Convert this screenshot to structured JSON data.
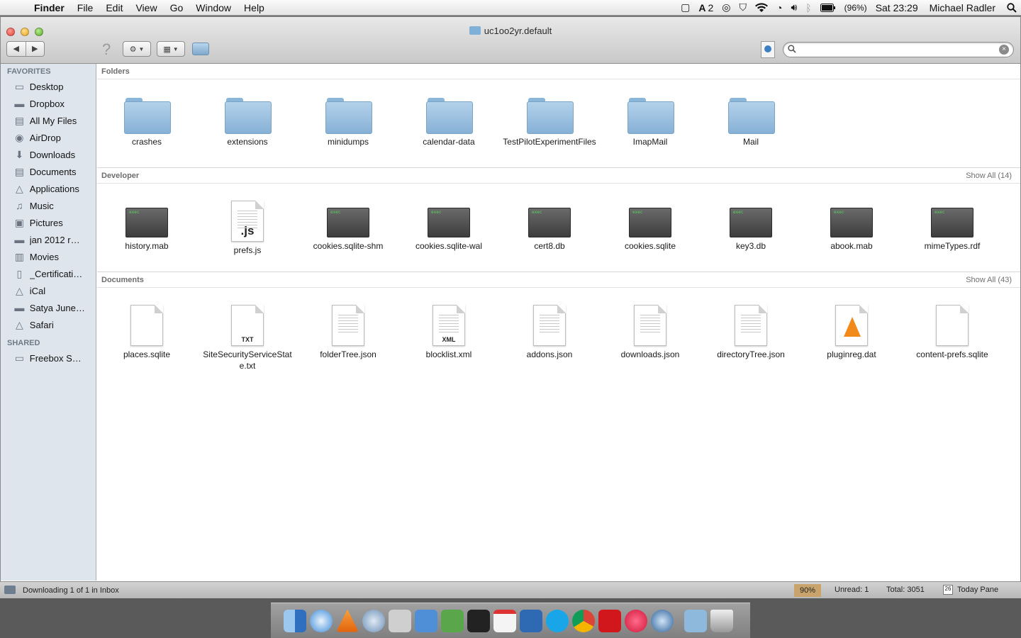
{
  "menubar": {
    "app": "Finder",
    "items": [
      "File",
      "Edit",
      "View",
      "Go",
      "Window",
      "Help"
    ],
    "adobe_count": "2",
    "battery": "(96%)",
    "clock": "Sat 23:29",
    "user": "Michael Radler"
  },
  "window": {
    "title": "uc1oo2yr.default",
    "search_placeholder": ""
  },
  "sidebar": {
    "favorites_header": "FAVORITES",
    "favorites": [
      {
        "label": "Desktop",
        "icon": "desktop-icon"
      },
      {
        "label": "Dropbox",
        "icon": "folder-icon"
      },
      {
        "label": "All My Files",
        "icon": "all-files-icon"
      },
      {
        "label": "AirDrop",
        "icon": "airdrop-icon"
      },
      {
        "label": "Downloads",
        "icon": "downloads-icon"
      },
      {
        "label": "Documents",
        "icon": "documents-icon"
      },
      {
        "label": "Applications",
        "icon": "applications-icon"
      },
      {
        "label": "Music",
        "icon": "music-icon"
      },
      {
        "label": "Pictures",
        "icon": "pictures-icon"
      },
      {
        "label": "jan 2012 r…",
        "icon": "folder-icon"
      },
      {
        "label": "Movies",
        "icon": "movies-icon"
      },
      {
        "label": "_Certificati…",
        "icon": "document-icon"
      },
      {
        "label": "iCal",
        "icon": "applications-icon"
      },
      {
        "label": "Satya June…",
        "icon": "folder-icon"
      },
      {
        "label": "Safari",
        "icon": "applications-icon"
      }
    ],
    "shared_header": "SHARED",
    "shared": [
      {
        "label": "Freebox S…",
        "icon": "network-server-icon"
      }
    ]
  },
  "sections": {
    "folders": {
      "title": "Folders",
      "items": [
        "crashes",
        "extensions",
        "minidumps",
        "calendar-data",
        "TestPilotExperimentFiles",
        "ImapMail",
        "Mail"
      ]
    },
    "developer": {
      "title": "Developer",
      "show_all": "Show All (14)",
      "items": [
        "history.mab",
        "prefs.js",
        "cookies.sqlite-shm",
        "cookies.sqlite-wal",
        "cert8.db",
        "cookies.sqlite",
        "key3.db",
        "abook.mab",
        "mimeTypes.rdf"
      ],
      "js_tag": ".js"
    },
    "documents": {
      "title": "Documents",
      "show_all": "Show All (43)",
      "items": [
        "places.sqlite",
        "SiteSecurityServiceState.txt",
        "folderTree.json",
        "blocklist.xml",
        "addons.json",
        "downloads.json",
        "directoryTree.json",
        "pluginreg.dat",
        "content-prefs.sqlite"
      ],
      "txt_tag": "TXT",
      "xml_tag": "XML"
    }
  },
  "statusbar": {
    "message": "Downloading 1 of 1 in Inbox",
    "zoom": "90%",
    "unread": "Unread: 1",
    "total": "Total: 3051",
    "today_pane": "Today Pane",
    "cal_day": "26"
  },
  "colors": {
    "sidebar_bg": "#dfe5ec",
    "folder_blue": "#86b1d6",
    "zoom_badge": "#c8a46c"
  }
}
